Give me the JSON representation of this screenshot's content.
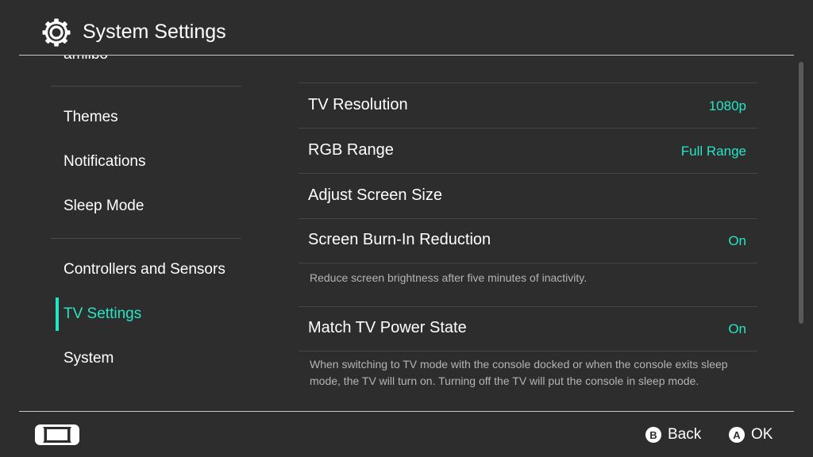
{
  "header": {
    "title": "System Settings",
    "icon": "gear-icon"
  },
  "sidebar": {
    "items": [
      {
        "label": "amiibo"
      },
      {
        "label": "Themes"
      },
      {
        "label": "Notifications"
      },
      {
        "label": "Sleep Mode"
      },
      {
        "label": "Controllers and Sensors"
      },
      {
        "label": "TV Settings",
        "active": true
      },
      {
        "label": "System"
      }
    ]
  },
  "settings": {
    "tv_resolution": {
      "label": "TV Resolution",
      "value": "1080p"
    },
    "rgb_range": {
      "label": "RGB Range",
      "value": "Full Range"
    },
    "adjust_screen_size": {
      "label": "Adjust Screen Size"
    },
    "burn_in": {
      "label": "Screen Burn-In Reduction",
      "value": "On",
      "description": "Reduce screen brightness after five minutes of inactivity."
    },
    "match_power": {
      "label": "Match TV Power State",
      "value": "On",
      "description": "When switching to TV mode with the console docked or when the console exits sleep mode, the TV will turn on. Turning off the TV will put the console in sleep mode."
    }
  },
  "footer": {
    "back": {
      "glyph": "B",
      "label": "Back"
    },
    "ok": {
      "glyph": "A",
      "label": "OK"
    },
    "console_icon": "handheld-console-icon"
  },
  "colors": {
    "accent": "#25e6c4",
    "background": "#2d2d2d"
  }
}
